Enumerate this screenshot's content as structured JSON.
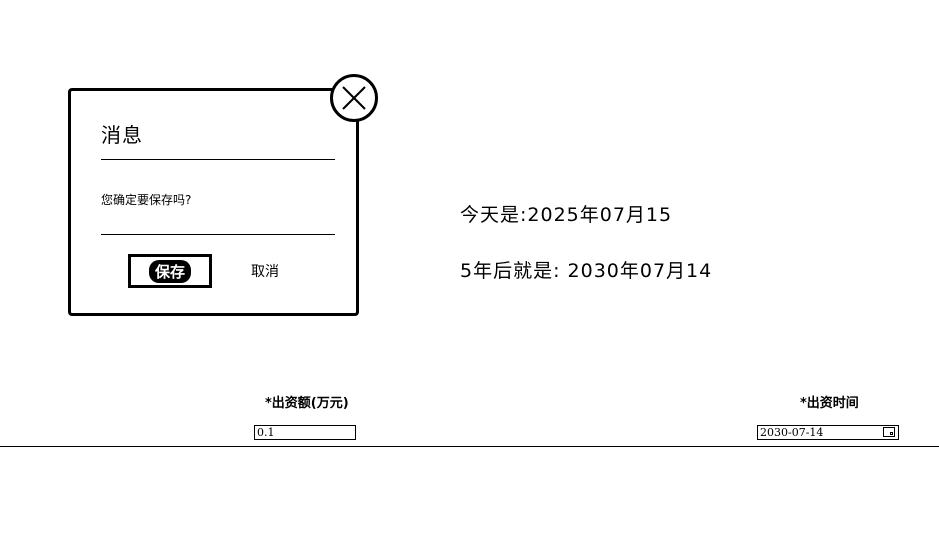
{
  "dialog": {
    "title": "消息",
    "message": "您确定要保存吗?",
    "save_label": "保存",
    "cancel_label": "取消"
  },
  "info": {
    "today": "今天是:2025年07月15",
    "after_five_years": "5年后就是: 2030年07月14"
  },
  "form": {
    "amount_label": "*出资额(万元)",
    "amount_value": "0.1",
    "time_label": "*出资时间",
    "time_value": "2030-07-14"
  }
}
